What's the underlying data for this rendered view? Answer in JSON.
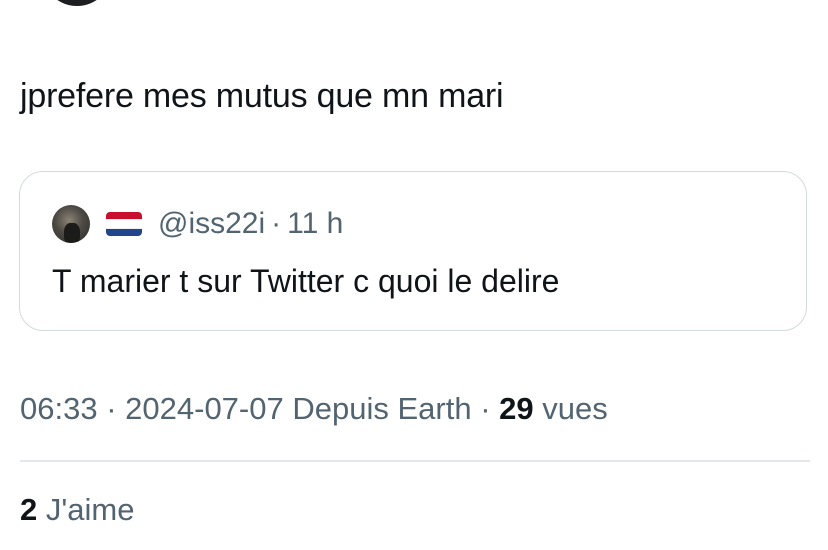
{
  "tweet": {
    "text": "jprefere mes mutus que mn mari"
  },
  "quoted_tweet": {
    "handle": "@iss22i",
    "separator": "·",
    "time": "11 h",
    "text": "T marier t sur Twitter c quoi le delire",
    "flag_icon": "netherlands-flag",
    "flag_colors": [
      "#c8102e",
      "#ffffff",
      "#21468b"
    ]
  },
  "meta": {
    "time": "06:33",
    "separator": "·",
    "date": "2024-07-07",
    "source": "Depuis Earth",
    "views_count": "29",
    "views_label": "vues"
  },
  "likes": {
    "count": "2",
    "label": "J'aime"
  },
  "colors": {
    "text_primary": "#0f1419",
    "text_secondary": "#536471",
    "border": "#d4dade"
  }
}
